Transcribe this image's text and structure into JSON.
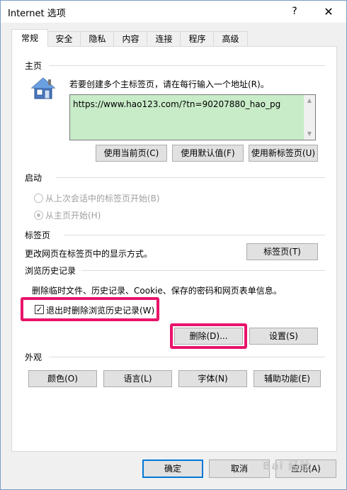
{
  "window": {
    "title": "Internet 选项",
    "help_glyph": "?",
    "close_glyph": "✕"
  },
  "tabs": [
    {
      "label": "常规",
      "active": true
    },
    {
      "label": "安全"
    },
    {
      "label": "隐私"
    },
    {
      "label": "内容"
    },
    {
      "label": "连接"
    },
    {
      "label": "程序"
    },
    {
      "label": "高级"
    }
  ],
  "homepage": {
    "section_label": "主页",
    "instruction": "若要创建多个主标签页，请在每行输入一个地址(R)。",
    "url": "https://www.hao123.com/?tn=90207880_hao_pg",
    "buttons": {
      "current": "使用当前页(C)",
      "default": "使用默认值(F)",
      "newtab": "使用新标签页(U)"
    }
  },
  "startup": {
    "section_label": "启动",
    "option_last": "从上次会话中的标签页开始(B)",
    "option_home": "从主页开始(H)"
  },
  "tabs_section": {
    "section_label": "标签页",
    "description": "更改网页在标签页中的显示方式。",
    "button": "标签页(T)"
  },
  "history": {
    "section_label": "浏览历史记录",
    "description": "删除临时文件、历史记录、Cookie、保存的密码和网页表单信息。",
    "checkbox_label": "退出时删除浏览历史记录(W)",
    "checkbox_mark": "✓",
    "delete_button": "删除(D)...",
    "settings_button": "设置(S)"
  },
  "appearance": {
    "section_label": "外观",
    "colors": "颜色(O)",
    "languages": "语言(L)",
    "fonts": "字体(N)",
    "accessibility": "辅助功能(E)"
  },
  "footer": {
    "ok": "确定",
    "cancel": "取消",
    "apply": "应用(A)",
    "watermark": "Bai 经验"
  },
  "colors": {
    "highlight": "#e8146a",
    "homepage_bg": "#c8ebc8",
    "default_button_border": "#0078d7"
  }
}
